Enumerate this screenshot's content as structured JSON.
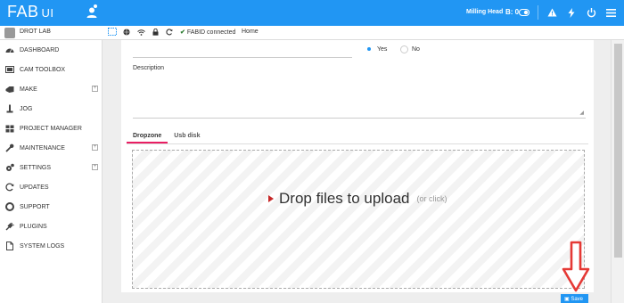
{
  "header": {
    "logo_main": "FAB",
    "logo_sub": "UI",
    "head_label": "Milling Head",
    "head_count": "B: 0",
    "icons": [
      "toggle-icon",
      "warning-icon",
      "lightning-icon",
      "power-icon",
      "menu-icon"
    ]
  },
  "subbar": {
    "user": "DROT LAB",
    "fabid": "FABID connected",
    "crumb": "Home"
  },
  "sidebar": {
    "items": [
      {
        "label": "DASHBOARD",
        "icon": "dashboard-icon",
        "expandable": false
      },
      {
        "label": "CAM TOOLBOX",
        "icon": "cam-icon",
        "expandable": false
      },
      {
        "label": "MAKE",
        "icon": "make-icon",
        "expandable": true
      },
      {
        "label": "JOG",
        "icon": "jog-icon",
        "expandable": false
      },
      {
        "label": "PROJECT MANAGER",
        "icon": "project-icon",
        "expandable": false
      },
      {
        "label": "MAINTENANCE",
        "icon": "wrench-icon",
        "expandable": true
      },
      {
        "label": "SETTINGS",
        "icon": "gear-icon",
        "expandable": true
      },
      {
        "label": "UPDATES",
        "icon": "refresh-icon",
        "expandable": false
      },
      {
        "label": "SUPPORT",
        "icon": "lifebuoy-icon",
        "expandable": false
      },
      {
        "label": "PLUGINS",
        "icon": "plug-icon",
        "expandable": false
      },
      {
        "label": "SYSTEM LOGS",
        "icon": "file-icon",
        "expandable": false
      }
    ]
  },
  "form": {
    "radio_yes": "Yes",
    "radio_no": "No",
    "selected": "Yes",
    "description_label": "Description",
    "description_value": ""
  },
  "tabs": [
    {
      "label": "Dropzone",
      "active": true
    },
    {
      "label": "Usb disk",
      "active": false
    }
  ],
  "dropzone": {
    "message": "Drop files to upload",
    "sub": "(or click)"
  },
  "save_label": "Save",
  "colors": {
    "primary": "#2196f3",
    "active_tab": "#e91e63",
    "annotation_arrow": "#e53935"
  }
}
